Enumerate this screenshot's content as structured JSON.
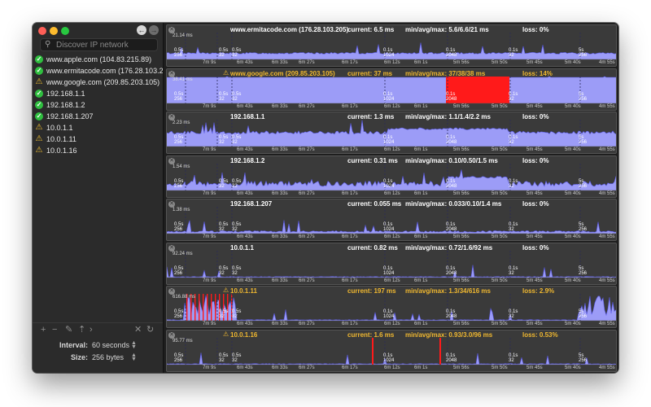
{
  "window": {
    "search": {
      "placeholder": "Discover IP network"
    }
  },
  "sidebar": {
    "hosts": [
      {
        "label": "www.apple.com (104.83.215.89)",
        "status": "ok"
      },
      {
        "label": "www.ermitacode.com (176.28.103.205)",
        "status": "ok"
      },
      {
        "label": "www.google.com (209.85.203.105)",
        "status": "warning"
      },
      {
        "label": "192.168.1.1",
        "status": "ok"
      },
      {
        "label": "192.168.1.2",
        "status": "ok"
      },
      {
        "label": "192.168.1.207",
        "status": "ok"
      },
      {
        "label": "10.0.1.1",
        "status": "warning"
      },
      {
        "label": "10.0.1.11",
        "status": "warning"
      },
      {
        "label": "10.0.1.16",
        "status": "warning"
      }
    ],
    "interval_label": "Interval:",
    "interval_value": "60 seconds",
    "size_label": "Size:",
    "size_value": "256 bytes"
  },
  "graphs": [
    {
      "host": "www.ermitacode.com (176.28.103.205)",
      "current": "current: 6.5 ms",
      "minmax": "min/avg/max: 5.6/6.6/21 ms",
      "loss": "loss: 0%",
      "max": "21.14 ms",
      "warning": false,
      "profile": "steady",
      "level": 0.23
    },
    {
      "host": "www.google.com (209.85.203.105)",
      "current": "current: 37 ms",
      "minmax": "min/avg/max: 37/38/38 ms",
      "loss": "loss: 14%",
      "max": "38.41 ms",
      "warning": true,
      "profile": "full",
      "level": 0.97
    },
    {
      "host": "192.168.1.1",
      "current": "current: 1.3 ms",
      "minmax": "min/avg/max: 1.1/1.4/2.2 ms",
      "loss": "loss: 0%",
      "max": "2.23 ms",
      "warning": false,
      "profile": "half",
      "level": 0.6
    },
    {
      "host": "192.168.1.2",
      "current": "current: 0.31 ms",
      "minmax": "min/avg/max: 0.10/0.50/1.5 ms",
      "loss": "loss: 0%",
      "max": "1.54 ms",
      "warning": false,
      "profile": "quarter",
      "level": 0.28
    },
    {
      "host": "192.168.1.207",
      "current": "current: 0.055 ms",
      "minmax": "min/avg/max: 0.033/0.10/1.4 ms",
      "loss": "loss: 0%",
      "max": "1.38 ms",
      "warning": false,
      "profile": "low",
      "level": 0.08
    },
    {
      "host": "10.0.1.1",
      "current": "current: 0.82 ms",
      "minmax": "min/avg/max: 0.72/1.6/92 ms",
      "loss": "loss: 0%",
      "max": "92.24 ms",
      "warning": false,
      "profile": "flat",
      "level": 0.01
    },
    {
      "host": "10.0.1.11",
      "current": "current: 197 ms",
      "minmax": "min/avg/max: 1.3/34/616 ms",
      "loss": "loss: 2.9%",
      "max": "616.88 ms",
      "warning": true,
      "profile": "burst",
      "level": 0.25
    },
    {
      "host": "10.0.1.16",
      "current": "current: 1.6 ms",
      "minmax": "min/avg/max: 0.93/3.0/96 ms",
      "loss": "loss: 0.53%",
      "max": "95.77 ms",
      "warning": true,
      "profile": "flat",
      "level": 0.02
    }
  ],
  "time_ticks": [
    "7m 9s",
    "6m 43s",
    "6m 33s",
    "6m 27s",
    "6m 17s",
    "6m 12s",
    "6m 1s",
    "5m 56s",
    "5m 50s",
    "5m 45s",
    "5m 40s",
    "4m 55s"
  ],
  "markers": [
    {
      "top": "0.5s",
      "bottom": "256"
    },
    {
      "top": "0.5s",
      "bottom": "32"
    },
    {
      "top": "0.5s",
      "bottom": "32"
    },
    {
      "top": "0.1s",
      "bottom": "1024"
    },
    {
      "top": "0.1s",
      "bottom": "2048"
    },
    {
      "top": "0.1s",
      "bottom": "32"
    },
    {
      "top": "5s",
      "bottom": "256"
    }
  ],
  "colors": {
    "fill": "#9c9cf7",
    "stroke": "#5a5ae8",
    "loss": "#ff1a1a",
    "warning": "#f0b830"
  }
}
